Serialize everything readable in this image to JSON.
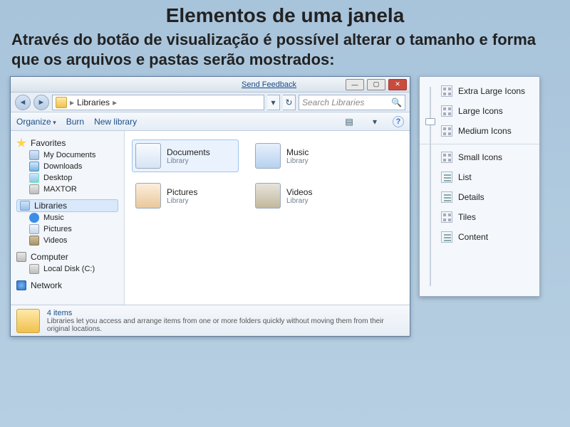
{
  "slide": {
    "title": "Elementos de uma janela",
    "text": "Através do botão de visualização é possível alterar o tamanho e forma que os arquivos e pastas serão mostrados:"
  },
  "window": {
    "feedback_link": "Send Feedback",
    "min_btn": "—",
    "max_btn": "▢",
    "close_btn": "✕",
    "address": {
      "root": "Libraries",
      "sep": "▸"
    },
    "nav_back": "◄",
    "nav_fwd": "►",
    "refresh_icon": "↻",
    "dropdown_icon": "▾",
    "search": {
      "placeholder": "Search Libraries",
      "icon": "🔍"
    },
    "toolbar": {
      "organize": "Organize",
      "burn": "Burn",
      "new_library": "New library",
      "view_icon": "▤",
      "help_icon": "?"
    }
  },
  "sidebar": {
    "favorites": {
      "label": "Favorites",
      "items": [
        {
          "label": "My Documents"
        },
        {
          "label": "Downloads"
        },
        {
          "label": "Desktop"
        },
        {
          "label": "MAXTOR"
        }
      ]
    },
    "libraries": {
      "label": "Libraries",
      "items": [
        {
          "label": "Music"
        },
        {
          "label": "Pictures"
        },
        {
          "label": "Videos"
        }
      ]
    },
    "computer": {
      "label": "Computer",
      "items": [
        {
          "label": "Local Disk (C:)"
        }
      ]
    },
    "network": {
      "label": "Network"
    }
  },
  "libraries_pane": {
    "subtitle": "Library",
    "items": [
      {
        "name": "Documents"
      },
      {
        "name": "Music"
      },
      {
        "name": "Pictures"
      },
      {
        "name": "Videos"
      }
    ]
  },
  "status": {
    "count": "4 items",
    "desc": "Libraries let you access and arrange items from one or more folders quickly without moving them from their original locations."
  },
  "view_menu": {
    "items": [
      {
        "label": "Extra Large Icons"
      },
      {
        "label": "Large Icons"
      },
      {
        "label": "Medium Icons"
      },
      {
        "label": "Small Icons"
      },
      {
        "label": "List"
      },
      {
        "label": "Details"
      },
      {
        "label": "Tiles"
      },
      {
        "label": "Content"
      }
    ]
  }
}
